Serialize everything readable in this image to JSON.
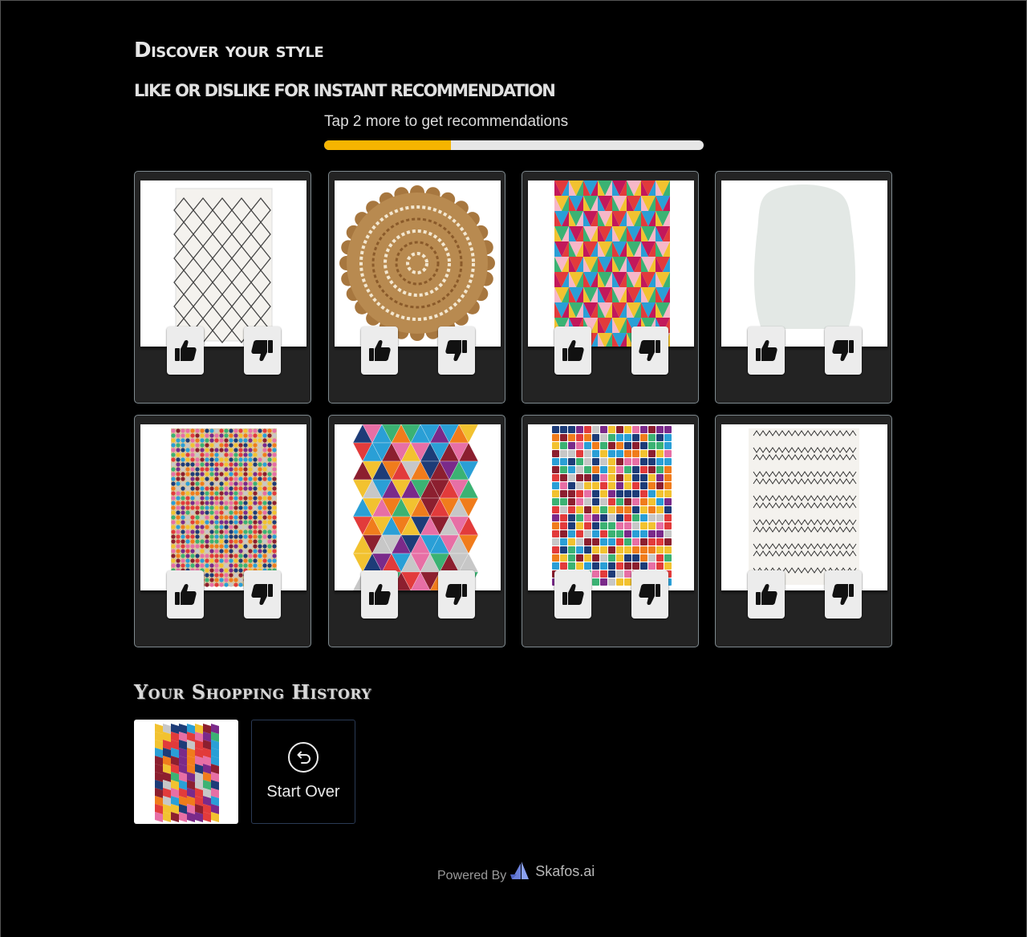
{
  "header": {
    "title": "Discover your style",
    "subtitle": "LIKE OR DISLIKE FOR INSTANT RECOMMENDATION"
  },
  "progress": {
    "label": "Tap 2 more to get recommendations",
    "fraction": 0.333,
    "color": "#f5b400"
  },
  "cards": [
    {
      "pattern": "white-diamond-lattice",
      "like_icon": "thumbs-up-icon",
      "dislike_icon": "thumbs-down-icon"
    },
    {
      "pattern": "round-jute-mandala",
      "like_icon": "thumbs-up-icon",
      "dislike_icon": "thumbs-down-icon"
    },
    {
      "pattern": "multicolor-cube-geometric",
      "like_icon": "thumbs-up-icon",
      "dislike_icon": "thumbs-down-icon"
    },
    {
      "pattern": "white-sheepskin",
      "like_icon": "thumbs-up-icon",
      "dislike_icon": "thumbs-down-icon"
    },
    {
      "pattern": "multicolor-dot-mosaic",
      "like_icon": "thumbs-up-icon",
      "dislike_icon": "thumbs-down-icon"
    },
    {
      "pattern": "multicolor-triangle-geometric",
      "like_icon": "thumbs-up-icon",
      "dislike_icon": "thumbs-down-icon"
    },
    {
      "pattern": "multicolor-pixel-squares",
      "like_icon": "thumbs-up-icon",
      "dislike_icon": "thumbs-down-icon"
    },
    {
      "pattern": "berber-tribal-monochrome",
      "like_icon": "thumbs-up-icon",
      "dislike_icon": "thumbs-down-icon"
    }
  ],
  "history": {
    "title": "Your Shopping History",
    "items": [
      {
        "pattern": "multicolor-diagonal-patchwork"
      }
    ],
    "start_over_label": "Start Over",
    "start_over_icon": "undo-circle-icon"
  },
  "footer": {
    "powered_by": "Powered By",
    "brand": "Skafos.ai",
    "brand_icon": "skafos-sail-logo"
  }
}
